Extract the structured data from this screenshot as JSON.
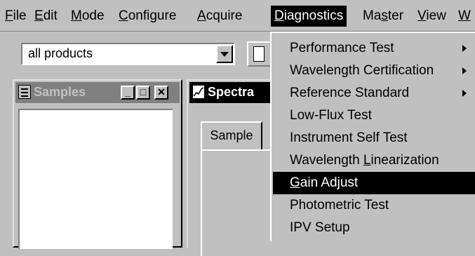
{
  "menubar": {
    "items": [
      {
        "pre": "",
        "u": "F",
        "post": "ile"
      },
      {
        "pre": "",
        "u": "E",
        "post": "dit"
      },
      {
        "pre": "",
        "u": "M",
        "post": "ode"
      },
      {
        "pre": "",
        "u": "C",
        "post": "onfigure"
      },
      {
        "pre": "",
        "u": "A",
        "post": "cquire"
      },
      {
        "pre": "",
        "u": "D",
        "post": "iagnostics"
      },
      {
        "pre": "Ma",
        "u": "s",
        "post": "ter"
      },
      {
        "pre": "",
        "u": "V",
        "post": "iew"
      },
      {
        "pre": "",
        "u": "W",
        "post": ""
      }
    ],
    "active_index": 5
  },
  "toolbar": {
    "product_combo_value": "all products"
  },
  "samples_window": {
    "title": "Samples",
    "min_glyph": "_",
    "max_glyph": "□",
    "close_glyph": "✕"
  },
  "spectra_window": {
    "title": "Spectra",
    "tab_label": "Sample"
  },
  "diagnostics_menu": {
    "items": [
      {
        "pre": "Performance Test",
        "u": "",
        "post": "",
        "submenu": true
      },
      {
        "pre": "Wavelength Certification",
        "u": "",
        "post": "",
        "submenu": true
      },
      {
        "pre": "Reference Standard",
        "u": "",
        "post": "",
        "submenu": true
      },
      {
        "pre": "Low-Flux Test",
        "u": "",
        "post": "",
        "submenu": false
      },
      {
        "pre": "Instrument Self Test",
        "u": "",
        "post": "",
        "submenu": false
      },
      {
        "pre": "Wavelength ",
        "u": "L",
        "post": "inearization",
        "submenu": false
      },
      {
        "pre": "",
        "u": "G",
        "post": "ain Adjust",
        "submenu": false,
        "selected": true
      },
      {
        "pre": "Photometric Test",
        "u": "",
        "post": "",
        "submenu": false
      },
      {
        "pre": "IPV Setup",
        "u": "",
        "post": "",
        "submenu": false
      }
    ]
  }
}
